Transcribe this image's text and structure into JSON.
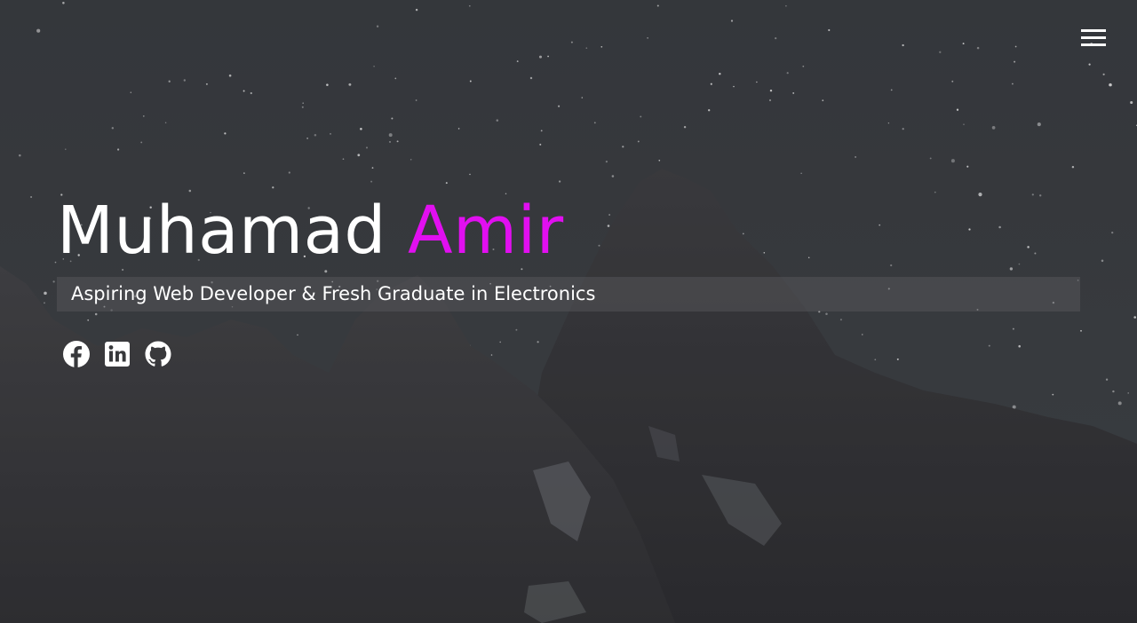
{
  "header": {
    "menu_icon": "hamburger-menu-icon"
  },
  "hero": {
    "first_name": "Muhamad",
    "last_name": "Amir",
    "tagline": "Aspiring Web Developer & Fresh Graduate in Electronics",
    "background": "night-sky-mountain-photo"
  },
  "socials": [
    {
      "icon": "facebook-icon"
    },
    {
      "icon": "linkedin-icon"
    },
    {
      "icon": "github-icon"
    }
  ],
  "colors": {
    "accent": "#e10ff0",
    "text": "#ffffff"
  }
}
